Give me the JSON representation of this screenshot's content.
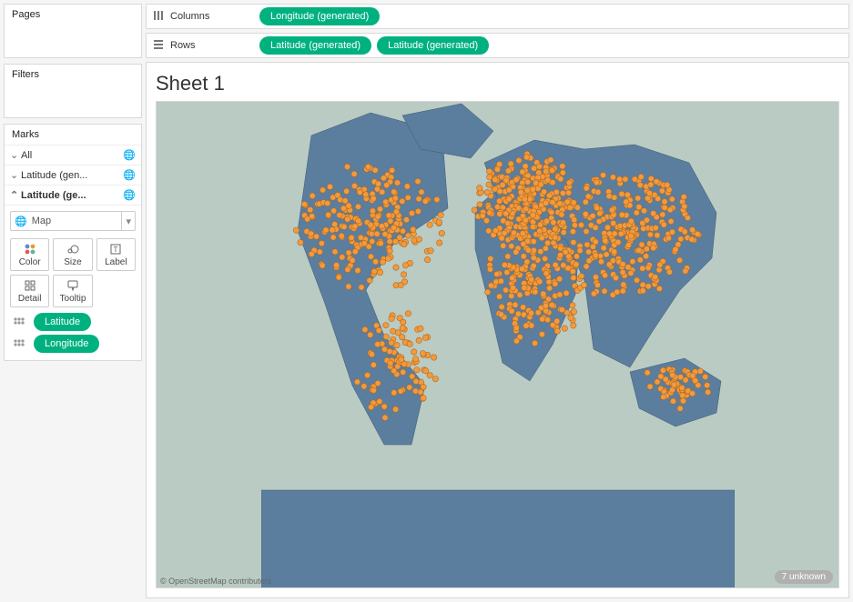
{
  "panels": {
    "pages": "Pages",
    "filters": "Filters",
    "marks": "Marks"
  },
  "marksLayers": {
    "all": "All",
    "lat1": "Latitude (gen...",
    "lat2": "Latitude (ge..."
  },
  "markType": "Map",
  "markProps": {
    "color": "Color",
    "size": "Size",
    "label": "Label",
    "detail": "Detail",
    "tooltip": "Tooltip"
  },
  "markFields": {
    "latitude": "Latitude",
    "longitude": "Longitude"
  },
  "shelves": {
    "columns": "Columns",
    "rows": "Rows"
  },
  "colPills": {
    "lon": "Longitude (generated)"
  },
  "rowPills": {
    "lat1": "Latitude (generated)",
    "lat2": "Latitude (generated)"
  },
  "vizTitle": "Sheet 1",
  "attribution": "© OpenStreetMap contributors",
  "unknownCount": "7 unknown"
}
